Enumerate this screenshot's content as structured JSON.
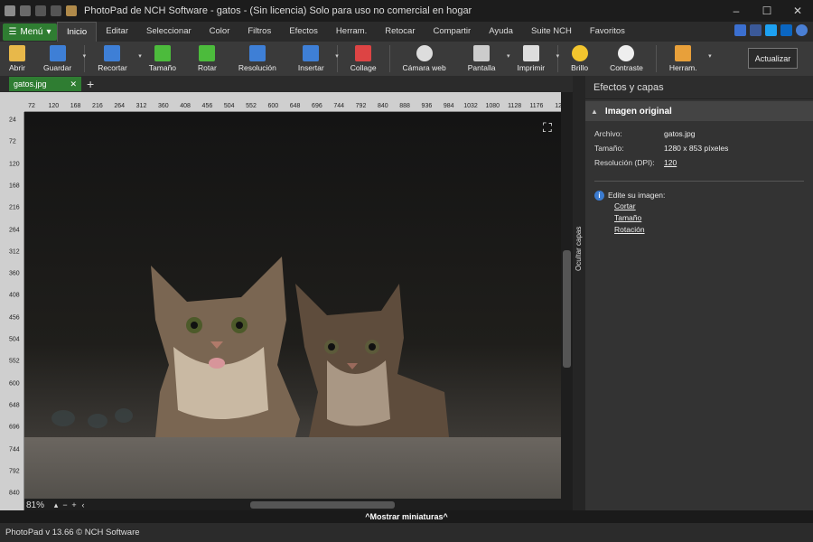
{
  "window": {
    "title": "PhotoPad de NCH Software - gatos - (Sin licencia) Solo para uso no comercial en hogar",
    "minimize": "–",
    "maximize": "☐",
    "close": "✕"
  },
  "menu": {
    "label": "Menú",
    "tabs": [
      "Inicio",
      "Editar",
      "Seleccionar",
      "Color",
      "Filtros",
      "Efectos",
      "Herram.",
      "Retocar",
      "Compartir",
      "Ayuda",
      "Suite NCH",
      "Favoritos"
    ]
  },
  "toolbar": {
    "buttons": [
      {
        "label": "Abrir",
        "icon": "folder-open-icon",
        "color": "#e8b84a"
      },
      {
        "label": "Guardar",
        "icon": "save-icon",
        "color": "#3e7fd6"
      },
      {
        "label": "Recortar",
        "icon": "crop-icon",
        "color": "#3e7fd6"
      },
      {
        "label": "Tamaño",
        "icon": "resize-icon",
        "color": "#4cbb3c"
      },
      {
        "label": "Rotar",
        "icon": "rotate-icon",
        "color": "#4cbb3c"
      },
      {
        "label": "Resolución",
        "icon": "resolution-icon",
        "color": "#3e7fd6"
      },
      {
        "label": "Insertar",
        "icon": "insert-icon",
        "color": "#3e7fd6"
      },
      {
        "label": "Collage",
        "icon": "collage-icon",
        "color": "#d44"
      },
      {
        "label": "Cámara web",
        "icon": "webcam-icon",
        "color": "#ddd"
      },
      {
        "label": "Pantalla",
        "icon": "screen-icon",
        "color": "#ccc"
      },
      {
        "label": "Imprimir",
        "icon": "print-icon",
        "color": "#ddd"
      },
      {
        "label": "Brillo",
        "icon": "brightness-icon",
        "color": "#f2c52e"
      },
      {
        "label": "Contraste",
        "icon": "contrast-icon",
        "color": "#eee"
      },
      {
        "label": "Herram.",
        "icon": "tools-icon",
        "color": "#e8a03a"
      }
    ],
    "update": "Actualizar"
  },
  "document": {
    "tab": "gatos.jpg",
    "add": "+"
  },
  "rulers": {
    "top": [
      "72",
      "120",
      "168",
      "216",
      "264",
      "312",
      "360",
      "408",
      "456",
      "504",
      "552",
      "600",
      "648",
      "696",
      "744",
      "792",
      "840",
      "888",
      "936",
      "984",
      "1032",
      "1080",
      "1128",
      "1176",
      "12"
    ],
    "left": [
      "24",
      "72",
      "120",
      "168",
      "216",
      "264",
      "312",
      "360",
      "408",
      "456",
      "504",
      "552",
      "600",
      "648",
      "696",
      "744",
      "792",
      "840"
    ]
  },
  "zoom": {
    "level": "81%"
  },
  "sidebar": {
    "toggle": "Ocultar capas"
  },
  "panel": {
    "title": "Efectos y capas",
    "section": "Imagen original",
    "props": [
      {
        "k": "Archivo:",
        "v": "gatos.jpg"
      },
      {
        "k": "Tamaño:",
        "v": "1280 x 853 píxeles"
      },
      {
        "k": "Resolución (DPI):",
        "v": "120"
      }
    ],
    "edit_title": "Edite su imagen:",
    "links": [
      "Cortar",
      "Tamaño",
      "Rotación"
    ]
  },
  "thumbnails": {
    "label": "Mostrar miniaturas"
  },
  "status": {
    "text": "PhotoPad v 13.66 © NCH Software"
  }
}
